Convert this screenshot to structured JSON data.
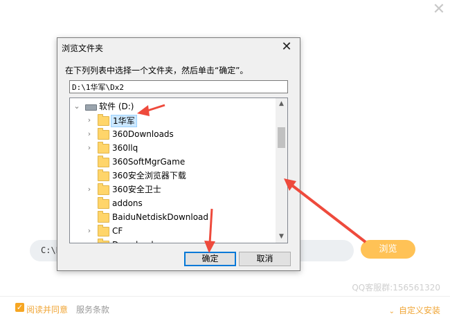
{
  "installer": {
    "close_glyph": "✕",
    "path_value": "C:\\P",
    "browse_label": "浏览",
    "qq_text": "QQ客服群:156561320",
    "agree_text": "阅读并同意",
    "terms_link": "服务条款",
    "custom_install": "自定义安装"
  },
  "dialog": {
    "title": "浏览文件夹",
    "close_glyph": "✕",
    "prompt": "在下列列表中选择一个文件夹，然后单击“确定”。",
    "path": "D:\\1华军\\Dx2",
    "ok_label": "确定",
    "cancel_label": "取消",
    "tree": {
      "drive_label": "软件 (D:)",
      "items": [
        {
          "label": "1华军",
          "expandable": true,
          "selected": true
        },
        {
          "label": "360Downloads",
          "expandable": true,
          "selected": false
        },
        {
          "label": "360llq",
          "expandable": true,
          "selected": false
        },
        {
          "label": "360SoftMgrGame",
          "expandable": false,
          "selected": false
        },
        {
          "label": "360安全浏览器下载",
          "expandable": false,
          "selected": false
        },
        {
          "label": "360安全卫士",
          "expandable": true,
          "selected": false
        },
        {
          "label": "addons",
          "expandable": false,
          "selected": false
        },
        {
          "label": "BaiduNetdiskDownload",
          "expandable": false,
          "selected": false
        },
        {
          "label": "CF",
          "expandable": true,
          "selected": false
        },
        {
          "label": "Downloads",
          "expandable": false,
          "selected": false
        }
      ]
    }
  },
  "colors": {
    "accent": "#ffc256",
    "annotation_arrow": "#ee4a3c",
    "selection": "#cce8ff"
  }
}
